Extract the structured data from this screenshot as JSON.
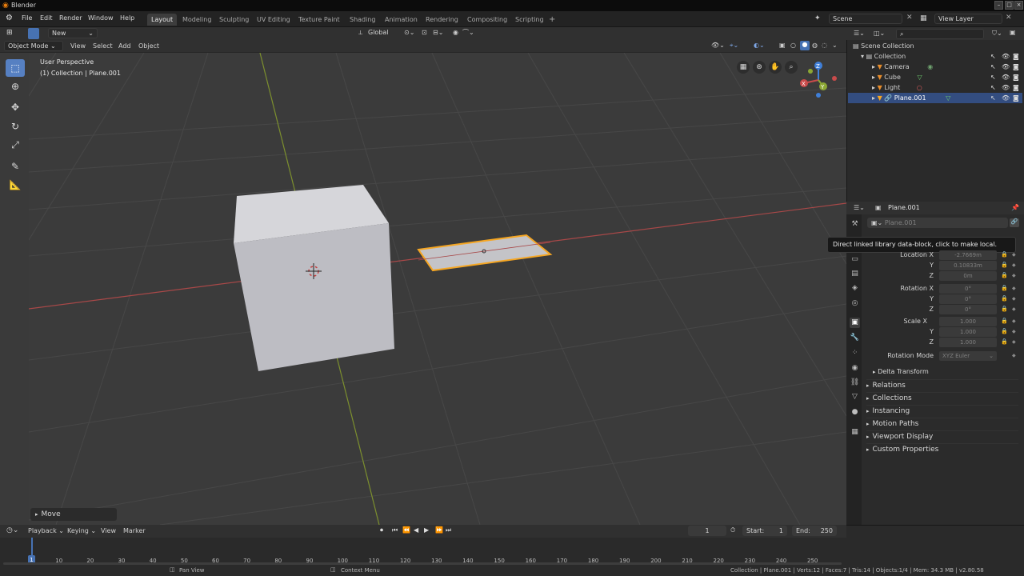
{
  "titlebar": {
    "title": "Blender"
  },
  "menu": [
    "File",
    "Edit",
    "Render",
    "Window",
    "Help"
  ],
  "workspaces": [
    "Layout",
    "Modeling",
    "Sculpting",
    "UV Editing",
    "Texture Paint",
    "Shading",
    "Animation",
    "Rendering",
    "Compositing",
    "Scripting",
    "+"
  ],
  "scene": {
    "name": "Scene",
    "view_layer": "View Layer"
  },
  "tool_header": {
    "new_label": "New",
    "orientation": "Global"
  },
  "viewport_header": {
    "mode": "Object Mode",
    "menus": [
      "View",
      "Select",
      "Add",
      "Object"
    ]
  },
  "viewport": {
    "perspective": "User Perspective",
    "collection_info": "(1) Collection | Plane.001",
    "gizmo": {
      "x": "X",
      "y": "Y",
      "z": "Z"
    }
  },
  "move_panel": "Move",
  "outliner": {
    "rows": [
      {
        "label": "Scene Collection"
      },
      {
        "label": "Collection"
      },
      {
        "label": "Camera"
      },
      {
        "label": "Cube"
      },
      {
        "label": "Light"
      },
      {
        "label": "Plane.001"
      }
    ]
  },
  "properties": {
    "object_name": "Plane.001",
    "object_field": "Plane.001",
    "tooltip": "Direct linked library data-block, click to make local.",
    "location_label": "Location X",
    "rotation_label": "Rotation X",
    "scale_label": "Scale X",
    "y": "Y",
    "z": "Z",
    "location": [
      "-2.7669m",
      "0.10833m",
      "0m"
    ],
    "rotation": [
      "0°",
      "0°",
      "0°"
    ],
    "scale": [
      "1.000",
      "1.000",
      "1.000"
    ],
    "rotation_mode_label": "Rotation Mode",
    "rotation_mode": "XYZ Euler",
    "delta": "Delta Transform",
    "panels": [
      "Relations",
      "Collections",
      "Instancing",
      "Motion Paths",
      "Viewport Display",
      "Custom Properties"
    ]
  },
  "timeline": {
    "menus": [
      "Playback",
      "Keying",
      "View",
      "Marker"
    ],
    "current_frame": "1",
    "start_label": "Start:",
    "start": "1",
    "end_label": "End:",
    "end": "250",
    "playhead": "1",
    "ticks": [
      "10",
      "20",
      "30",
      "40",
      "50",
      "60",
      "70",
      "80",
      "90",
      "100",
      "110",
      "120",
      "130",
      "140",
      "150",
      "160",
      "170",
      "180",
      "190",
      "200",
      "210",
      "220",
      "230",
      "240",
      "250"
    ]
  },
  "statusbar": {
    "pan": "Pan View",
    "context": "Context Menu",
    "stats": "Collection | Plane.001 | Verts:12 | Faces:7 | Tris:14 | Objects:1/4 | Mem: 34.3 MB | v2.80.58"
  },
  "colors": {
    "accent": "#4772b3",
    "selection": "#f5a623",
    "x_axis": "#c94b4b",
    "y_axis": "#8ca734",
    "z_axis": "#3f7fd8"
  }
}
